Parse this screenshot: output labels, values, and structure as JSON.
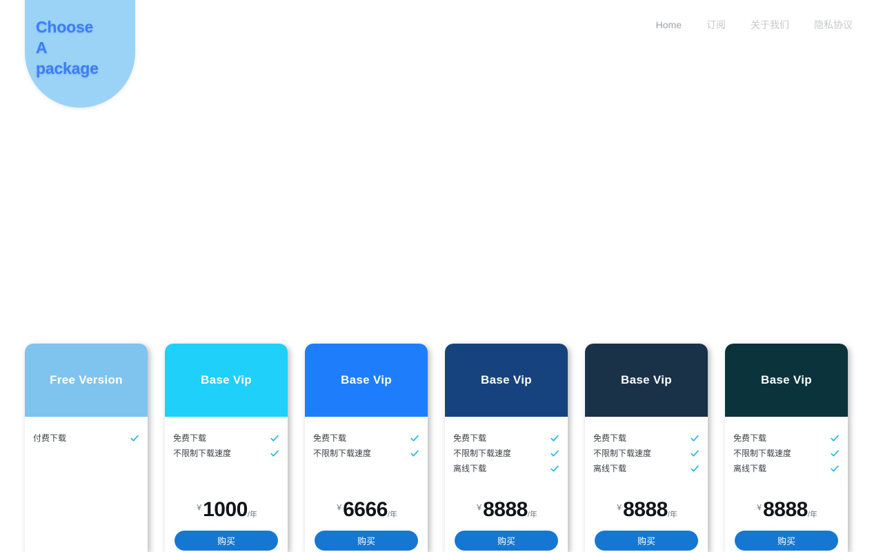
{
  "hero": {
    "title": "Choose\nA\npackage",
    "bg_color": "#9bd3f7",
    "text_color": "#3c7ef5"
  },
  "nav": {
    "items": [
      {
        "label": "Home",
        "active": true
      },
      {
        "label": "订阅",
        "active": false
      },
      {
        "label": "关于我们",
        "active": false
      },
      {
        "label": "隐私协议",
        "active": false
      }
    ]
  },
  "pricing": {
    "check_color": "#25b6ec",
    "buy_button_color": "#1677d2",
    "cards": [
      {
        "title": "Free Version",
        "header_color": "#7fc4ef",
        "features": [
          "付费下载"
        ],
        "has_price": false,
        "currency": "",
        "amount": "",
        "period": "",
        "buy_label": ""
      },
      {
        "title": "Base Vip",
        "header_color": "#1ed0fa",
        "features": [
          "免费下载",
          "不限制下载速度"
        ],
        "has_price": true,
        "currency": "￥",
        "amount": "1000",
        "period": "/年",
        "buy_label": "购买"
      },
      {
        "title": "Base Vip",
        "header_color": "#1e7dfb",
        "features": [
          "免费下载",
          "不限制下载速度"
        ],
        "has_price": true,
        "currency": "￥",
        "amount": "6666",
        "period": "/年",
        "buy_label": "购买"
      },
      {
        "title": "Base Vip",
        "header_color": "#16437e",
        "features": [
          "免费下载",
          "不限制下载速度",
          "离线下载"
        ],
        "has_price": true,
        "currency": "￥",
        "amount": "8888",
        "period": "/年",
        "buy_label": "购买"
      },
      {
        "title": "Base Vip",
        "header_color": "#1a3248",
        "features": [
          "免费下载",
          "不限制下载速度",
          "离线下载"
        ],
        "has_price": true,
        "currency": "￥",
        "amount": "8888",
        "period": "/年",
        "buy_label": "购买"
      },
      {
        "title": "Base Vip",
        "header_color": "#0b333b",
        "features": [
          "免费下载",
          "不限制下载速度",
          "离线下载"
        ],
        "has_price": true,
        "currency": "￥",
        "amount": "8888",
        "period": "/年",
        "buy_label": "购买"
      }
    ]
  }
}
